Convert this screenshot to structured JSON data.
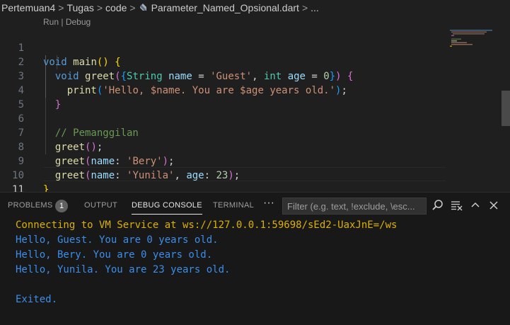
{
  "breadcrumb": {
    "items": [
      "Pertemuan4",
      "Tugas",
      "code",
      "Parameter_Named_Opsional.dart",
      "..."
    ],
    "separator": ">"
  },
  "codelens": {
    "run": "Run",
    "sep": " | ",
    "debug": "Debug"
  },
  "editor": {
    "line_numbers": [
      "1",
      "2",
      "3",
      "4",
      "5",
      "6",
      "7",
      "8",
      "9",
      "10",
      "11"
    ],
    "active_line": "11",
    "lines": {
      "l1": {
        "kw": "void",
        "fn": "main",
        "p1o": "(",
        "p1c": ")",
        "sp": " ",
        "b1": "{"
      },
      "l2": {
        "kw": "void",
        "fn": "greet",
        "p2o": "(",
        "b3o": "{",
        "ty1": "String",
        "v1": "name",
        "eq1": " = ",
        "s1": "'Guest'",
        "comma": ", ",
        "ty2": "int",
        "v2": "age",
        "eq2": " = ",
        "n1": "0",
        "b3c": "}",
        "p2c": ")",
        "b2": "{"
      },
      "l3": {
        "fn": "print",
        "p3o": "(",
        "s": "'Hello, $name. You are $age years old.'",
        "p3c": ")",
        "end": ";"
      },
      "l4": {
        "b2": "}"
      },
      "l6": {
        "comment": "// Pemanggilan"
      },
      "l7": {
        "fn": "greet",
        "p": "()",
        "end": ";"
      },
      "l8": {
        "fn": "greet",
        "po": "(",
        "v": "name",
        "colon": ": ",
        "s": "'Bery'",
        "pc": ")",
        "end": ";"
      },
      "l9": {
        "fn": "greet",
        "po": "(",
        "v1": "name",
        "colon1": ": ",
        "s": "'Yunila'",
        "comma": ", ",
        "v2": "age",
        "colon2": ": ",
        "n": "23",
        "pc": ")",
        "end": ";"
      },
      "l10": {
        "b1": "}"
      }
    }
  },
  "panel": {
    "tabs": {
      "problems": "PROBLEMS",
      "output": "OUTPUT",
      "debug_console": "DEBUG CONSOLE",
      "terminal": "TERMINAL"
    },
    "problems_count": "1",
    "more": "···",
    "filter_placeholder": "Filter (e.g. text, !exclude, \\esc...",
    "icons": [
      "search-icon",
      "clear-console-icon",
      "chevron-up-icon",
      "close-icon"
    ]
  },
  "console": {
    "lines": [
      "Connecting to VM Service at ws://127.0.0.1:59698/sEd2-UaxJnE=/ws",
      "Hello, Guest. You are 0 years old.",
      "Hello, Bery. You are 0 years old.",
      "Hello, Yunila. You are 23 years old.",
      "",
      "Exited."
    ]
  },
  "colors": {
    "background": "#1f1f1f",
    "panel": "#181818",
    "keyword": "#569cd6",
    "function": "#dcdcaa",
    "type": "#4ec9b0",
    "variable": "#9cdcfe",
    "string": "#ce9178",
    "number": "#b5cea8",
    "comment": "#6a9955",
    "console_info": "#dcb000",
    "console_output": "#3b8eea"
  }
}
